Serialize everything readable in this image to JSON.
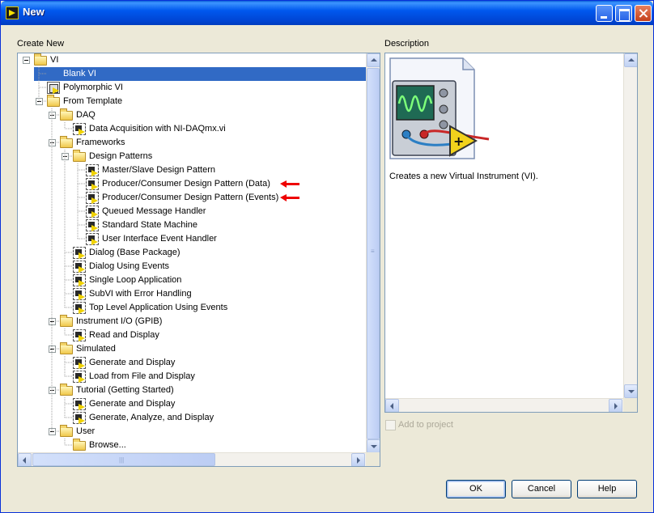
{
  "window": {
    "title": "New"
  },
  "left_panel": {
    "label": "Create New"
  },
  "tree": [
    {
      "label": "VI",
      "level": 0,
      "type": "folder",
      "expanded": true
    },
    {
      "label": "Blank VI",
      "level": 1,
      "type": "vi",
      "selected": true
    },
    {
      "label": "Polymorphic VI",
      "level": 1,
      "type": "poly"
    },
    {
      "label": "From Template",
      "level": 1,
      "type": "folder",
      "expanded": true
    },
    {
      "label": "DAQ",
      "level": 2,
      "type": "folder",
      "expanded": true
    },
    {
      "label": "Data Acquisition with NI-DAQmx.vi",
      "level": 3,
      "type": "template"
    },
    {
      "label": "Frameworks",
      "level": 2,
      "type": "folder",
      "expanded": true
    },
    {
      "label": "Design Patterns",
      "level": 3,
      "type": "folder",
      "expanded": true
    },
    {
      "label": "Master/Slave Design Pattern",
      "level": 4,
      "type": "template"
    },
    {
      "label": "Producer/Consumer Design Pattern (Data)",
      "level": 4,
      "type": "template",
      "marked": true
    },
    {
      "label": "Producer/Consumer Design Pattern (Events)",
      "level": 4,
      "type": "template",
      "marked": true
    },
    {
      "label": "Queued Message Handler",
      "level": 4,
      "type": "template"
    },
    {
      "label": "Standard State Machine",
      "level": 4,
      "type": "template"
    },
    {
      "label": "User Interface Event Handler",
      "level": 4,
      "type": "template"
    },
    {
      "label": "Dialog (Base Package)",
      "level": 3,
      "type": "template"
    },
    {
      "label": "Dialog Using Events",
      "level": 3,
      "type": "template"
    },
    {
      "label": "Single Loop Application",
      "level": 3,
      "type": "template"
    },
    {
      "label": "SubVI with Error Handling",
      "level": 3,
      "type": "template"
    },
    {
      "label": "Top Level Application Using Events",
      "level": 3,
      "type": "template"
    },
    {
      "label": "Instrument I/O (GPIB)",
      "level": 2,
      "type": "folder",
      "expanded": true
    },
    {
      "label": "Read and Display",
      "level": 3,
      "type": "template"
    },
    {
      "label": "Simulated",
      "level": 2,
      "type": "folder",
      "expanded": true
    },
    {
      "label": "Generate and Display",
      "level": 3,
      "type": "template"
    },
    {
      "label": "Load from File and Display",
      "level": 3,
      "type": "template"
    },
    {
      "label": "Tutorial (Getting Started)",
      "level": 2,
      "type": "folder",
      "expanded": true
    },
    {
      "label": "Generate and Display",
      "level": 3,
      "type": "template"
    },
    {
      "label": "Generate, Analyze, and Display",
      "level": 3,
      "type": "template"
    },
    {
      "label": "User",
      "level": 2,
      "type": "folder",
      "expanded": true
    },
    {
      "label": "Browse...",
      "level": 3,
      "type": "folder"
    }
  ],
  "right_panel": {
    "label": "Description",
    "description": "Creates a new Virtual Instrument (VI)."
  },
  "add_to_project": {
    "label": "Add to project",
    "checked": false,
    "enabled": false
  },
  "buttons": {
    "ok": "OK",
    "cancel": "Cancel",
    "help": "Help"
  },
  "colors": {
    "selection": "#316ac5",
    "marker": "#e00000",
    "titlebar": "#0058ee"
  }
}
